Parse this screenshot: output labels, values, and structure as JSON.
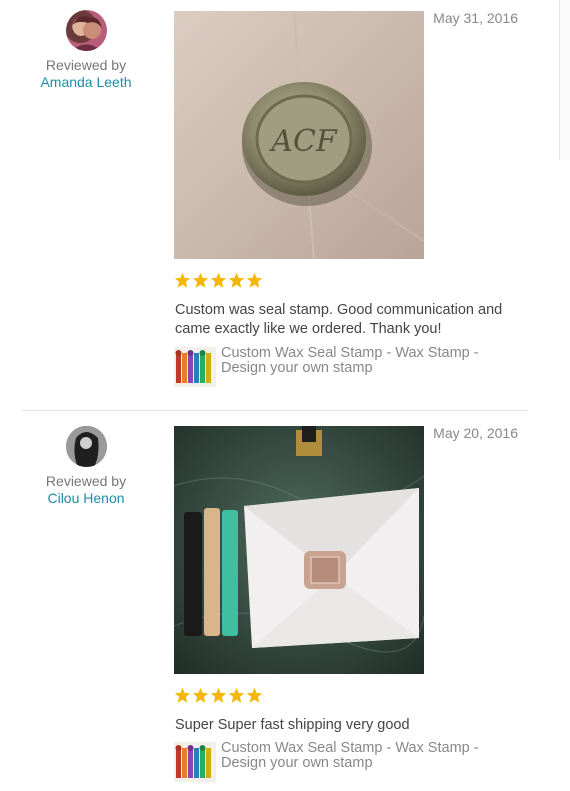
{
  "reviews": [
    {
      "reviewed_by_label": "Reviewed by",
      "reviewer_name": "Amanda Leeth",
      "date": "May 31, 2016",
      "rating": 5,
      "text": "Custom was seal stamp. Good communication and came exactly like we ordered. Thank you!",
      "product_title": "Custom Wax Seal Stamp - Wax Stamp - Design your own stamp"
    },
    {
      "reviewed_by_label": "Reviewed by",
      "reviewer_name": "Cilou Henon",
      "date": "May 20, 2016",
      "rating": 5,
      "text": "Super Super fast shipping very good",
      "product_title": "Custom Wax Seal Stamp - Wax Stamp - Design your own stamp"
    }
  ],
  "colors": {
    "star": "#f5b700",
    "link": "#1a8fa6",
    "muted": "#888888"
  },
  "icons": [
    "star-icon"
  ]
}
